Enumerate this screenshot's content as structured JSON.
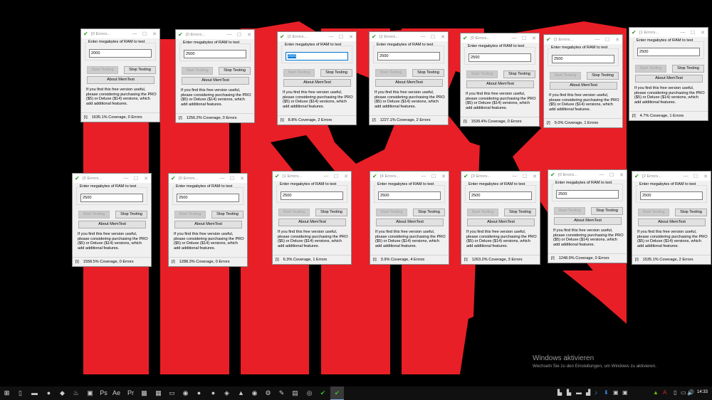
{
  "colors": {
    "wallpaper_red": "#e81f27",
    "wallpaper_black": "#000000",
    "selection": "#0078d7"
  },
  "common": {
    "group_label": "Enter megabytes of RAM to test",
    "start_label": "Start Testing",
    "stop_label": "Stop Testing",
    "about_label": "About MemTest",
    "info_text": "If you find this free version useful, please considering purchasing the PRO ($5) or Deluxe ($14) versions, which add additional features.",
    "minimize": "—",
    "maximize": "☐",
    "close": "✕"
  },
  "windows": [
    {
      "title": "[0 Errors...",
      "ram": "2000",
      "spinner": "[\\]",
      "coverage": "1635.1% Coverage, 0 Errors"
    },
    {
      "title": "[0 Errors...",
      "ram": "2500",
      "spinner": "[/]",
      "coverage": "1256.2% Coverage, 0 Errors"
    },
    {
      "title": "[2 Errors...",
      "ram": "2500",
      "spinner": "[\\]",
      "coverage": "8.8% Coverage, 2 Errors",
      "selected": true
    },
    {
      "title": "[2 Errors...",
      "ram": "2500",
      "spinner": "[/]",
      "coverage": "1227.1% Coverage, 2 Errors"
    },
    {
      "title": "[0 Errors...",
      "ram": "2500",
      "spinner": "[\\]",
      "coverage": "1539.4% Coverage, 0 Errors"
    },
    {
      "title": "[1 Errors...",
      "ram": "2500",
      "spinner": "[/]",
      "coverage": "9.0% Coverage, 1 Errors"
    },
    {
      "title": "[1 Errors...",
      "ram": "2500",
      "spinner": "[/]",
      "coverage": "4.7% Coverage, 1 Errors"
    },
    {
      "title": "[0 Errors...",
      "ram": "2500",
      "spinner": "[\\]",
      "coverage": "1558.5% Coverage, 0 Errors"
    },
    {
      "title": "[0 Errors...",
      "ram": "2500",
      "spinner": "[/]",
      "coverage": "1288.3% Coverage, 0 Errors"
    },
    {
      "title": "[1 Errors...",
      "ram": "2500",
      "spinner": "[\\]",
      "coverage": "6.3% Coverage, 1 Errors"
    },
    {
      "title": "[4 Errors...",
      "ram": "2500",
      "spinner": "[\\]",
      "coverage": "3.9% Coverage, 4 Errors"
    },
    {
      "title": "[3 Errors...",
      "ram": "2500",
      "spinner": "[\\]",
      "coverage": "1263.2% Coverage, 3 Errors"
    },
    {
      "title": "[0 Errors...",
      "ram": "2500",
      "spinner": "[/]",
      "coverage": "1248.9% Coverage, 0 Errors"
    },
    {
      "title": "[2 Errors...",
      "ram": "2500",
      "spinner": "[/]",
      "coverage": "1535.1% Coverage, 2 Errors"
    }
  ],
  "watermark": {
    "title": "Windows aktivieren",
    "subtitle": "Wechseln Sie zu den Einstellungen, um Windows zu aktivieren."
  },
  "taskbar": {
    "icons": [
      "start-icon",
      "task-view-icon",
      "file-explorer-icon",
      "firefox-icon",
      "app-icon",
      "steam-icon",
      "app-icon",
      "photoshop-icon",
      "after-effects-icon",
      "premiere-icon",
      "app-icon",
      "app-icon",
      "app-icon",
      "discord-icon",
      "app-icon",
      "app-icon",
      "app-icon",
      "app-icon",
      "app-icon",
      "app-icon",
      "app-icon",
      "app-icon",
      "app-icon",
      "memtest-icon",
      "memtest-icon"
    ],
    "glyphs": [
      "⊞",
      "▯",
      "▬",
      "●",
      "◆",
      "♨",
      "▣",
      "Ps",
      "Ae",
      "Pr",
      "▩",
      "▦",
      "▭",
      "◉",
      "●",
      "●",
      "◈",
      "▲",
      "◉",
      "⚙",
      "✎",
      "▤",
      "◎",
      "✔",
      "✔"
    ],
    "tray_glyphs": [
      "▙",
      "▙",
      "▬",
      "▟",
      "♪",
      "⬇",
      "▣",
      "▣"
    ],
    "tray_right": [
      "▲",
      "A",
      "▯",
      "▭",
      "🔊"
    ],
    "clock": "14:33"
  }
}
